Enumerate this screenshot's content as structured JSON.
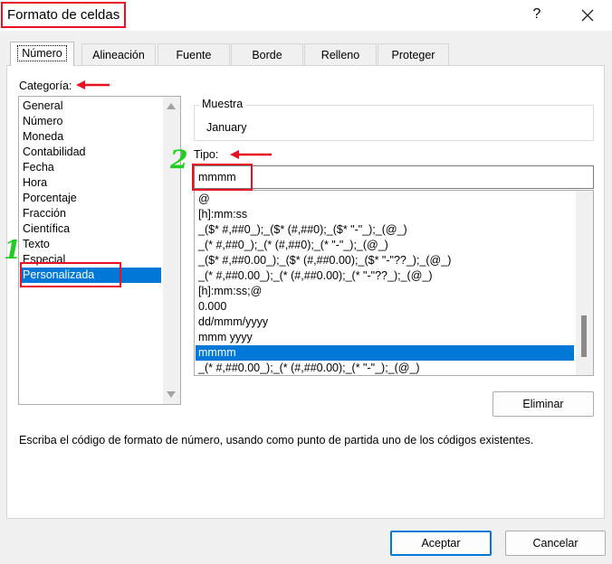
{
  "window": {
    "title": "Formato de celdas",
    "help_glyph": "?",
    "close_icon": "close-icon"
  },
  "tabs": [
    {
      "label": "Número",
      "active": true
    },
    {
      "label": "Alineación"
    },
    {
      "label": "Fuente"
    },
    {
      "label": "Borde"
    },
    {
      "label": "Relleno"
    },
    {
      "label": "Proteger"
    }
  ],
  "category": {
    "label": "Categoría:",
    "items": [
      "General",
      "Número",
      "Moneda",
      "Contabilidad",
      "Fecha",
      "Hora",
      "Porcentaje",
      "Fracción",
      "Científica",
      "Texto",
      "Especial",
      "Personalizada"
    ],
    "selected": "Personalizada"
  },
  "sample": {
    "label": "Muestra",
    "value": "January"
  },
  "type": {
    "label": "Tipo:",
    "value": "mmmm",
    "items": [
      "@",
      "[h]:mm:ss",
      "_($* #,##0_);_($* (#,##0);_($* \"-\"_);_(@_)",
      "_(* #,##0_);_(* (#,##0);_(* \"-\"_);_(@_)",
      "_($* #,##0.00_);_($* (#,##0.00);_($* \"-\"??_);_(@_)",
      "_(* #,##0.00_);_(* (#,##0.00);_(* \"-\"??_);_(@_)",
      "[h]:mm:ss;@",
      "0.000",
      "dd/mmm/yyyy",
      "mmm yyyy",
      "mmmm",
      "_(* #,##0.00_);_(* (#,##0.00);_(* \"-\"_);_(@_)"
    ],
    "selected": "mmmm"
  },
  "buttons": {
    "delete": "Eliminar",
    "ok": "Aceptar",
    "cancel": "Cancelar"
  },
  "hint": "Escriba el código de formato de número, usando como punto de partida uno de los códigos existentes.",
  "annotations": {
    "step1": "1",
    "step2": "2",
    "color_box": "#e81123",
    "color_number": "#22cc22"
  },
  "colors": {
    "selection": "#0078d7",
    "panel": "#ffffff",
    "background": "#f0f0f0"
  }
}
